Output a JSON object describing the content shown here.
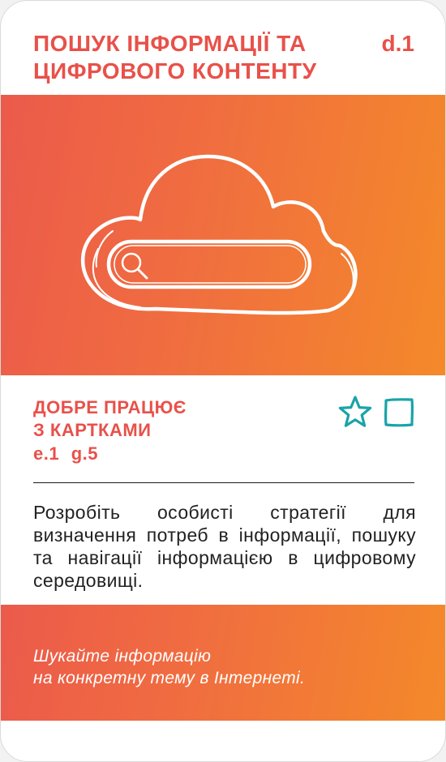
{
  "card": {
    "title_line1": "ПОШУК ІНФОРМАЦІЇ ТА",
    "title_line2": "ЦИФРОВОГО КОНТЕНТУ",
    "code": "d.1"
  },
  "hero": {
    "icon": "cloud-search-icon"
  },
  "works_well": {
    "line1": "ДОБРЕ ПРАЦЮЄ",
    "line2": "З КАРТКАМИ",
    "tags": [
      "e.1",
      "g.5"
    ]
  },
  "icons": {
    "favorite": "star-icon",
    "select": "checkbox-icon"
  },
  "description": "Розробіть особисті стратегії для визначення потреб в інформації, пошуку та навігації інформацією в цифровому середовищі.",
  "tip": {
    "line1": "Шукайте інформацію",
    "line2": "на конкретну тему в Інтернеті."
  },
  "colors": {
    "accent": "#e8514a",
    "gradient_start": "#ec5a4b",
    "gradient_end": "#f4892a",
    "teal": "#1aa3a8"
  }
}
